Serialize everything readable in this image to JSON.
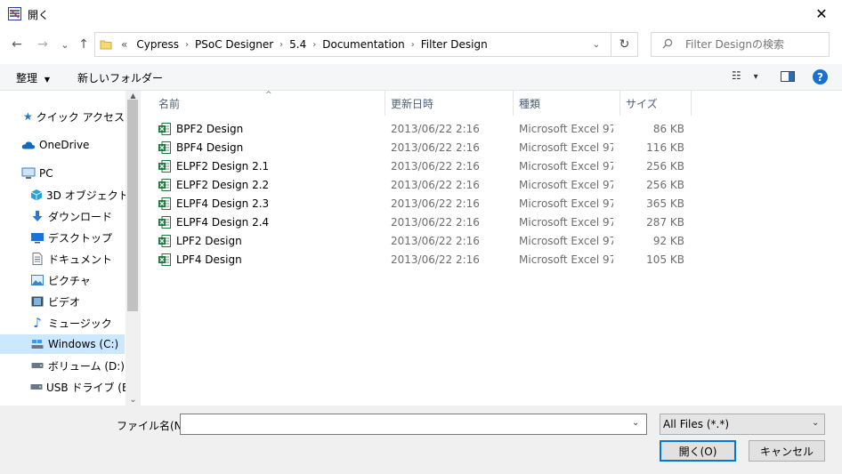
{
  "window": {
    "title": "開く",
    "icon": "app-window-icon",
    "close_glyph": "✕"
  },
  "nav_buttons": {
    "back": "←",
    "forward": "→",
    "recent": "⌄",
    "up": "↑"
  },
  "address": {
    "folder_icon": "folder-icon",
    "overflow": "«",
    "separator": "›",
    "crumbs": [
      "Cypress",
      "PSoC Designer",
      "5.4",
      "Documentation",
      "Filter Design"
    ],
    "dropdown_glyph": "⌄",
    "refresh_glyph": "↻"
  },
  "search": {
    "placeholder": "Filter Designの検索",
    "icon": "search-icon"
  },
  "toolbar": {
    "organize": "整理",
    "organize_arrow": "▼",
    "new_folder": "新しいフォルダー",
    "view_glyph": "☷",
    "view_arrow": "▾",
    "help": "?"
  },
  "nav_pane": {
    "items": [
      {
        "label": "クイック アクセス",
        "icon": "star-icon",
        "color": "#1e78d6"
      },
      {
        "label": "OneDrive",
        "icon": "cloud-icon",
        "color": "#0f6cbd"
      },
      {
        "label": "PC",
        "icon": "computer-icon",
        "color": "#3d7bc4"
      },
      {
        "label": "3D オブジェクト",
        "icon": "cube-icon",
        "color": "#29a3d6"
      },
      {
        "label": "ダウンロード",
        "icon": "download-icon",
        "color": "#2a77d4"
      },
      {
        "label": "デスクトップ",
        "icon": "desktop-icon",
        "color": "#1a73d9"
      },
      {
        "label": "ドキュメント",
        "icon": "document-icon",
        "color": "#6b7785"
      },
      {
        "label": "ピクチャ",
        "icon": "picture-icon",
        "color": "#3a86c8"
      },
      {
        "label": "ビデオ",
        "icon": "video-icon",
        "color": "#40505e"
      },
      {
        "label": "ミュージック",
        "icon": "music-icon",
        "color": "#1e78d6"
      },
      {
        "label": "Windows (C:)",
        "icon": "drive-icon",
        "color": "#3d6fa8",
        "selected": true
      },
      {
        "label": "ボリューム (D:)",
        "icon": "drive-icon",
        "color": "#555"
      },
      {
        "label": "USB ドライブ (E:)",
        "icon": "drive-icon",
        "color": "#555"
      }
    ],
    "scroll_up": "▲",
    "scroll_down": "⌄"
  },
  "columns": {
    "name": "名前",
    "date": "更新日時",
    "type": "種類",
    "size": "サイズ",
    "sort_arrow": "^"
  },
  "files": [
    {
      "name": "BPF2 Design",
      "date": "2013/06/22 2:16",
      "type": "Microsoft Excel 97...",
      "size": "86 KB"
    },
    {
      "name": "BPF4 Design",
      "date": "2013/06/22 2:16",
      "type": "Microsoft Excel 97...",
      "size": "116 KB"
    },
    {
      "name": "ELPF2 Design 2.1",
      "date": "2013/06/22 2:16",
      "type": "Microsoft Excel 97...",
      "size": "256 KB"
    },
    {
      "name": "ELPF2 Design 2.2",
      "date": "2013/06/22 2:16",
      "type": "Microsoft Excel 97...",
      "size": "256 KB"
    },
    {
      "name": "ELPF4 Design 2.3",
      "date": "2013/06/22 2:16",
      "type": "Microsoft Excel 97...",
      "size": "365 KB"
    },
    {
      "name": "ELPF4 Design 2.4",
      "date": "2013/06/22 2:16",
      "type": "Microsoft Excel 97...",
      "size": "287 KB"
    },
    {
      "name": "LPF2 Design",
      "date": "2013/06/22 2:16",
      "type": "Microsoft Excel 97...",
      "size": "92 KB"
    },
    {
      "name": "LPF4 Design",
      "date": "2013/06/22 2:16",
      "type": "Microsoft Excel 97...",
      "size": "105 KB"
    }
  ],
  "file_icon": "excel-file-icon",
  "bottom": {
    "filename_label": "ファイル名(N):",
    "filename_value": "",
    "filename_dd": "⌄",
    "filter": "All Files (*.*)",
    "filter_dd": "⌄",
    "open": "開く(O)",
    "cancel": "キャンセル"
  },
  "colors": {
    "accent": "#0078d7",
    "selected_bg": "#cce8ff",
    "toolbar_bg": "#f5f6f7",
    "bottom_bg": "#f0f0f0",
    "excel_green": "#1d7a3d"
  }
}
